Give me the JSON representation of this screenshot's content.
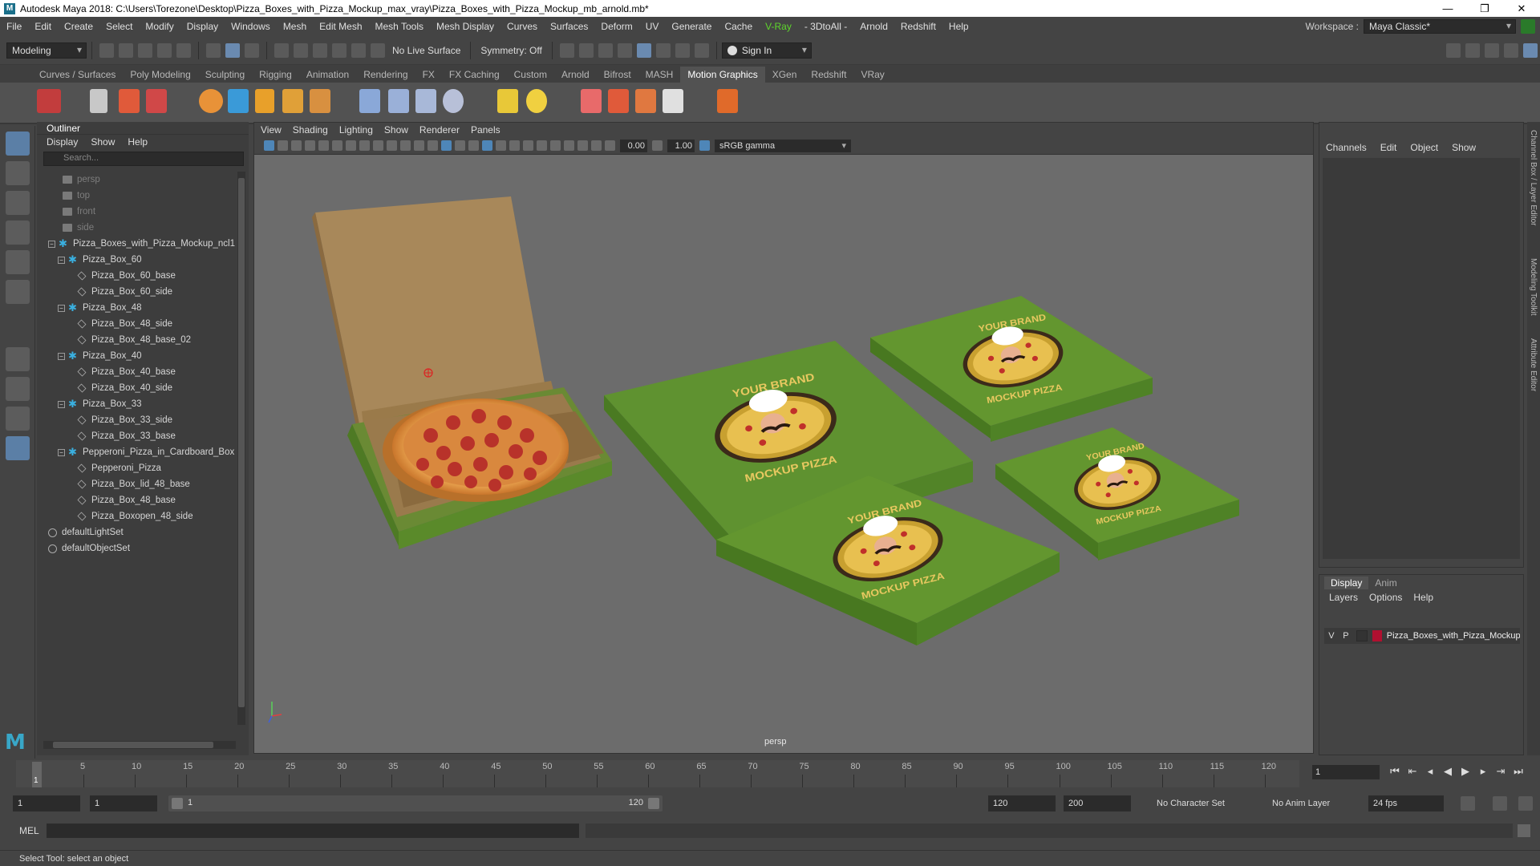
{
  "window": {
    "title": "Autodesk Maya 2018: C:\\Users\\Torezone\\Desktop\\Pizza_Boxes_with_Pizza_Mockup_max_vray\\Pizza_Boxes_with_Pizza_Mockup_mb_arnold.mb*",
    "logo_letter": "M",
    "minimize": "—",
    "maximize": "❐",
    "close": "✕"
  },
  "menubar": {
    "items": [
      "File",
      "Edit",
      "Create",
      "Select",
      "Modify",
      "Display",
      "Windows",
      "Mesh",
      "Edit Mesh",
      "Mesh Tools",
      "Mesh Display",
      "Curves",
      "Surfaces",
      "Deform",
      "UV",
      "Generate",
      "Cache",
      "V-Ray",
      "- 3DtoAll -",
      "Arnold",
      "Redshift",
      "Help"
    ],
    "workspace_label": "Workspace :",
    "workspace_value": "Maya Classic*"
  },
  "statusline": {
    "mode": "Modeling",
    "live_surface": "No Live Surface",
    "symmetry": "Symmetry: Off",
    "sign_in": "Sign In"
  },
  "shelf": {
    "tabs": [
      "Curves / Surfaces",
      "Poly Modeling",
      "Sculpting",
      "Rigging",
      "Animation",
      "Rendering",
      "FX",
      "FX Caching",
      "Custom",
      "Arnold",
      "Bifrost",
      "MASH",
      "Motion Graphics",
      "XGen",
      "Redshift",
      "VRay"
    ],
    "active_tab": "Motion Graphics"
  },
  "outliner": {
    "title": "Outliner",
    "menu": [
      "Display",
      "Show",
      "Help"
    ],
    "search_placeholder": "Search...",
    "rows": [
      {
        "label": "persp",
        "type": "camera",
        "depth": 0
      },
      {
        "label": "top",
        "type": "camera",
        "depth": 0
      },
      {
        "label": "front",
        "type": "camera",
        "depth": 0
      },
      {
        "label": "side",
        "type": "camera",
        "depth": 0
      },
      {
        "label": "Pizza_Boxes_with_Pizza_Mockup_ncl1",
        "type": "group",
        "depth": 0,
        "expanded": true
      },
      {
        "label": "Pizza_Box_60",
        "type": "group",
        "depth": 1,
        "expanded": true
      },
      {
        "label": "Pizza_Box_60_base",
        "type": "mesh",
        "depth": 2
      },
      {
        "label": "Pizza_Box_60_side",
        "type": "mesh",
        "depth": 2
      },
      {
        "label": "Pizza_Box_48",
        "type": "group",
        "depth": 1,
        "expanded": true
      },
      {
        "label": "Pizza_Box_48_side",
        "type": "mesh",
        "depth": 2
      },
      {
        "label": "Pizza_Box_48_base_02",
        "type": "mesh",
        "depth": 2
      },
      {
        "label": "Pizza_Box_40",
        "type": "group",
        "depth": 1,
        "expanded": true
      },
      {
        "label": "Pizza_Box_40_base",
        "type": "mesh",
        "depth": 2
      },
      {
        "label": "Pizza_Box_40_side",
        "type": "mesh",
        "depth": 2
      },
      {
        "label": "Pizza_Box_33",
        "type": "group",
        "depth": 1,
        "expanded": true
      },
      {
        "label": "Pizza_Box_33_side",
        "type": "mesh",
        "depth": 2
      },
      {
        "label": "Pizza_Box_33_base",
        "type": "mesh",
        "depth": 2
      },
      {
        "label": "Pepperoni_Pizza_in_Cardboard_Box",
        "type": "group",
        "depth": 1,
        "expanded": true
      },
      {
        "label": "Pepperoni_Pizza",
        "type": "mesh",
        "depth": 2
      },
      {
        "label": "Pizza_Box_lid_48_base",
        "type": "mesh",
        "depth": 2
      },
      {
        "label": "Pizza_Box_48_base",
        "type": "mesh",
        "depth": 2
      },
      {
        "label": "Pizza_Boxopen_48_side",
        "type": "mesh",
        "depth": 2
      },
      {
        "label": "defaultLightSet",
        "type": "set",
        "depth": 0
      },
      {
        "label": "defaultObjectSet",
        "type": "set",
        "depth": 0
      }
    ]
  },
  "viewport": {
    "menu": [
      "View",
      "Shading",
      "Lighting",
      "Show",
      "Renderer",
      "Panels"
    ],
    "exposure": "0.00",
    "gamma": "1.00",
    "color_space": "sRGB gamma",
    "camera_label": "persp",
    "box_text_top": "YOUR BRAND",
    "box_text_bottom": "MOCKUP PIZZA"
  },
  "channelbox": {
    "menu": [
      "Channels",
      "Edit",
      "Object",
      "Show"
    ]
  },
  "layers": {
    "tabs": [
      "Display",
      "Anim"
    ],
    "active_tab": "Display",
    "menu": [
      "Layers",
      "Options",
      "Help"
    ],
    "row": {
      "v": "V",
      "p": "P",
      "name": "Pizza_Boxes_with_Pizza_Mockup",
      "color": "#b01030"
    }
  },
  "side_tabs": [
    "Channel Box / Layer Editor",
    "Modeling Toolkit",
    "Attribute Editor"
  ],
  "timeline": {
    "labels": [
      "5",
      "10",
      "15",
      "20",
      "25",
      "30",
      "35",
      "40",
      "45",
      "50",
      "55",
      "60",
      "65",
      "70",
      "75",
      "80",
      "85",
      "90",
      "95",
      "100",
      "105",
      "110",
      "115",
      "120"
    ],
    "current_frame": "1",
    "current_frame_field": "1"
  },
  "range": {
    "start": "1",
    "playback_start": "1",
    "slider_start": "1",
    "slider_end": "120",
    "playback_end": "120",
    "end": "200",
    "character_set": "No Character Set",
    "anim_layer": "No Anim Layer",
    "fps": "24 fps"
  },
  "commandline": {
    "label": "MEL"
  },
  "helpline": {
    "text": "Select Tool: select an object"
  },
  "colors": {
    "box_green": "#5a8f2e",
    "cardboard": "#a8885a",
    "pizza_crust": "#d9873a",
    "pepperoni": "#b8322a"
  }
}
